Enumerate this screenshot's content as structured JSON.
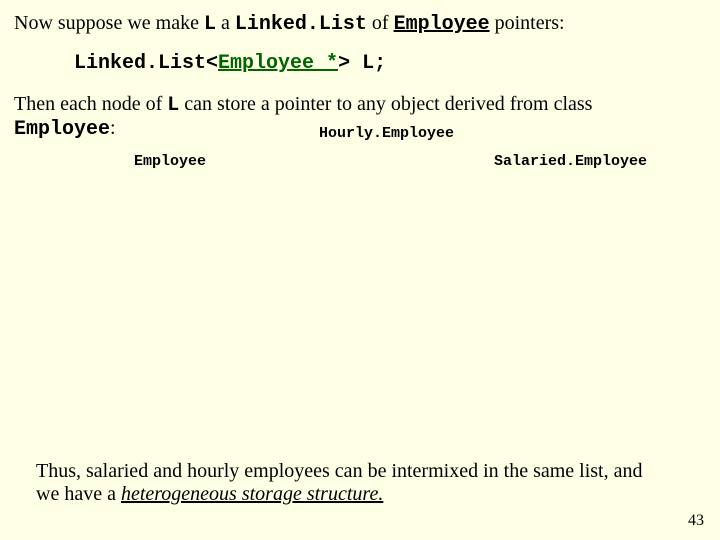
{
  "line1": {
    "t1": "Now suppose we make ",
    "v1": "L",
    "t2": " a ",
    "v2": "Linked.List",
    "t3": " of ",
    "v3": "Employee",
    "t4": " pointers:"
  },
  "code": {
    "p1": "Linked.List<",
    "p2": "Employee *",
    "p3": "> L;"
  },
  "para2": {
    "t1": "Then each node of ",
    "v1": "L",
    "t2": " can store a pointer to any object derived from class",
    "v2": "Employee",
    "t3": ":"
  },
  "labels": {
    "hourly": "Hourly.Employee",
    "employee": "Employee",
    "salaried": "Salaried.Employee"
  },
  "bottom": {
    "t1": "Thus, salaried and hourly employees can be intermixed in the same list, and we have a ",
    "h": "heterogeneous storage structure.",
    "t2": ""
  },
  "pagenum": "43"
}
